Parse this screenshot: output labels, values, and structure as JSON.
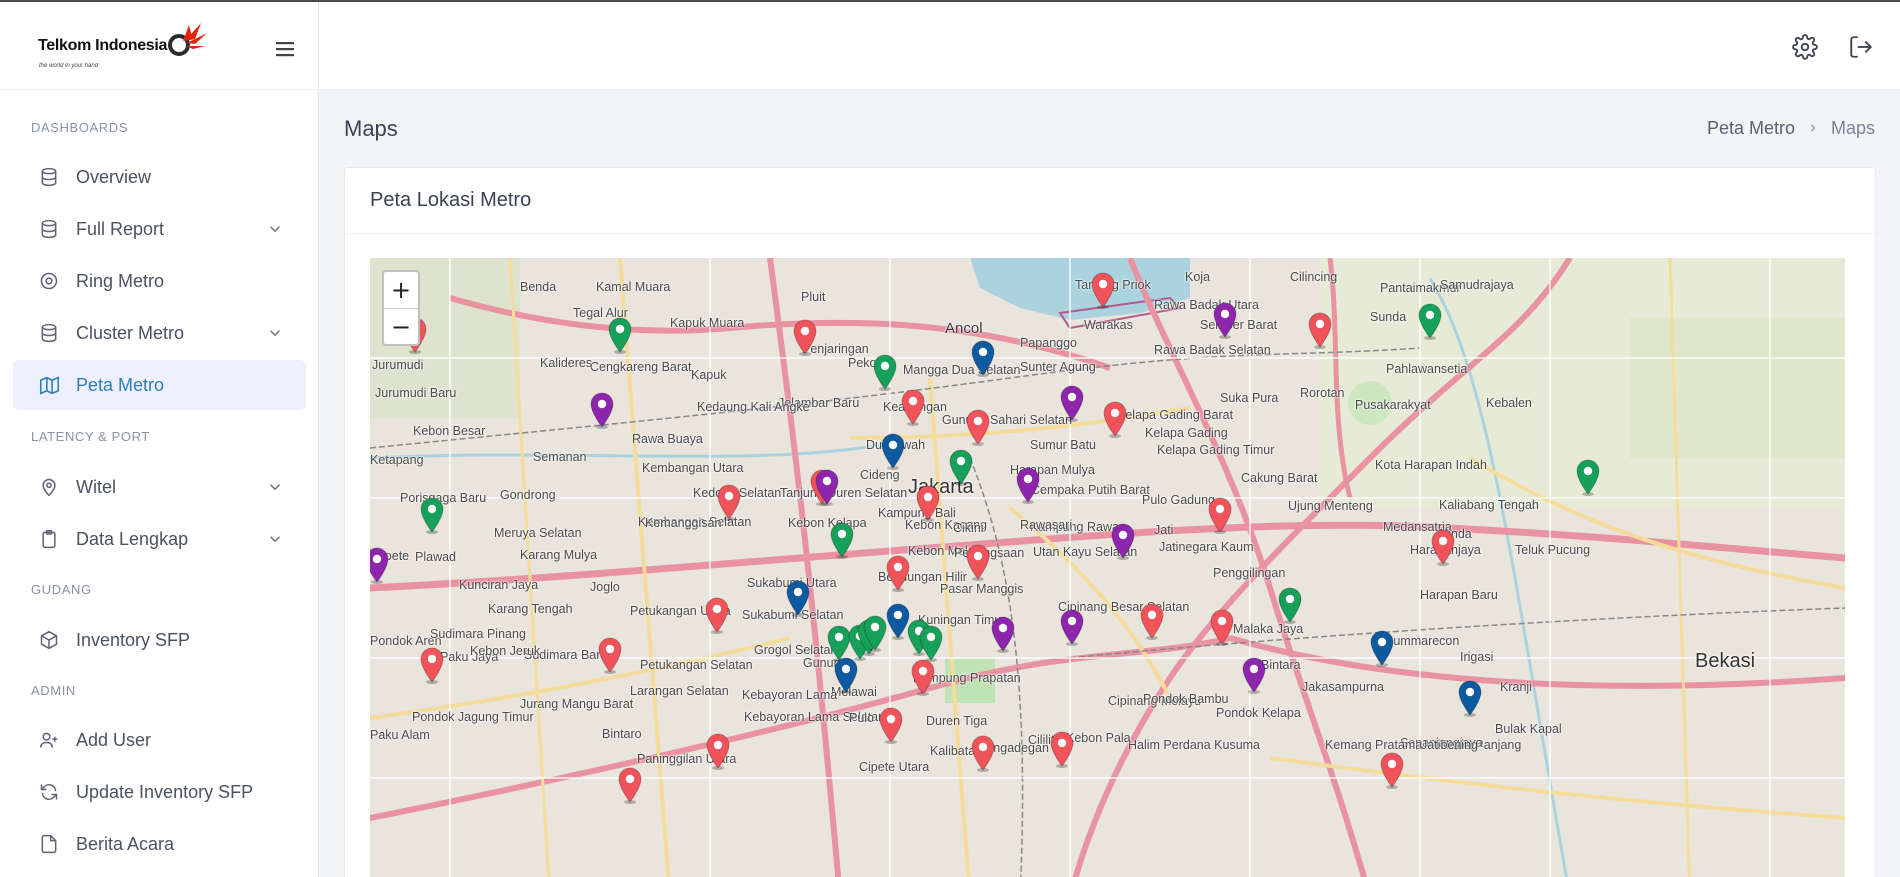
{
  "brand": {
    "name": "Telkom Indonesia",
    "tagline": "the world in your hand",
    "accent": "#e42313"
  },
  "sidebar": {
    "sections": [
      {
        "title": "DASHBOARDS",
        "items": [
          {
            "label": "Overview",
            "icon": "database-icon",
            "has_chevron": false
          },
          {
            "label": "Full Report",
            "icon": "database-icon",
            "has_chevron": true
          },
          {
            "label": "Ring Metro",
            "icon": "target-icon",
            "has_chevron": false
          },
          {
            "label": "Cluster Metro",
            "icon": "database-icon",
            "has_chevron": true
          },
          {
            "label": "Peta Metro",
            "icon": "map-icon",
            "has_chevron": false,
            "active": true
          }
        ]
      },
      {
        "title": "LATENCY & PORT",
        "items": [
          {
            "label": "Witel",
            "icon": "map-pin-icon",
            "has_chevron": true
          },
          {
            "label": "Data Lengkap",
            "icon": "clipboard-icon",
            "has_chevron": true
          }
        ]
      },
      {
        "title": "GUDANG",
        "items": [
          {
            "label": "Inventory SFP",
            "icon": "box-icon",
            "has_chevron": false
          }
        ]
      },
      {
        "title": "ADMIN",
        "items": [
          {
            "label": "Add User",
            "icon": "user-plus-icon",
            "has_chevron": false
          },
          {
            "label": "Update Inventory SFP",
            "icon": "refresh-icon",
            "has_chevron": false
          },
          {
            "label": "Berita Acara",
            "icon": "file-icon",
            "has_chevron": false
          }
        ]
      }
    ]
  },
  "topbar": {
    "settings_icon": "gear-icon",
    "logout_icon": "logout-icon"
  },
  "page": {
    "title": "Maps",
    "breadcrumb": [
      "Peta Metro",
      "Maps"
    ]
  },
  "card": {
    "title": "Peta Lokasi Metro"
  },
  "map": {
    "zoom_in": "+",
    "zoom_out": "−",
    "marker_colors": {
      "red": "#f0545a",
      "green": "#16a05a",
      "blue": "#0e5aa0",
      "purple": "#8e26ad"
    },
    "labels": [
      "Jakarta",
      "Bekasi",
      "Ancol",
      "Kapuk Muara",
      "Pluit",
      "Penjaringan",
      "Tegal Alur",
      "Cengkareng Barat",
      "Kapuk",
      "Jelambar Baru",
      "Kedaung Kali Angke",
      "Rawa Buaya",
      "Kembangan Utara",
      "Kembangan Selatan",
      "Kedoya Selatan",
      "Tanjung Duren Selatan",
      "Cideng",
      "Kampung Bali",
      "Kebon Kacang",
      "Kebon Melati",
      "Bendungan Hilir",
      "Sukabumi Utara",
      "Sukabumi Selatan",
      "Grogol Selatan",
      "Gunung",
      "Melawai",
      "Kebayoran Lama",
      "Kebayoran Lama Selatan",
      "Cipete Utara",
      "Pulo",
      "Duren Tiga",
      "Kalibata",
      "Pasar Manggis",
      "Kuningan Timur",
      "Kampung Prapatan",
      "Pegangsaan",
      "Cikini",
      "Kampung Rawa",
      "Cempaka Putih Barat",
      "Harapan Mulya",
      "Sumur Batu",
      "Gunung Sahari Selatan",
      "Mangga Dua Selatan",
      "Keagungan",
      "Pekojan",
      "Papanggo",
      "Sunter Agung",
      "Warakas",
      "Tanjung Priok",
      "Rawa Badak Utara",
      "Rawa Badak Selatan",
      "Koja",
      "Semper Barat",
      "Cilincing",
      "Kelapa Gading Barat",
      "Kelapa Gading Timur",
      "Pulo Gadung",
      "Jati",
      "Jatinegara Kaum",
      "Rawasari",
      "Utan Kayu Selatan",
      "Cipinang Besar Selatan",
      "Cipinang Melayu",
      "Pondok Bambu",
      "Halim Perdana Kusuma",
      "Kebon Pala",
      "Cililitan",
      "Pengadegan",
      "Pondok Kelapa",
      "Malaka Jaya",
      "Penggilingan",
      "Cakung Barat",
      "Ujung Menteng",
      "Rorotan",
      "Suka Pura",
      "Pusakarakyat",
      "Pahlawansetia",
      "Pantaimakmur",
      "Samudrajaya",
      "Kebalen",
      "Kaliabang Tengah",
      "Medansatria",
      "Harapanjaya",
      "Harapan Baru",
      "Summarecon",
      "Irigasi",
      "Jakasampurna",
      "Bintara",
      "Kranji",
      "Rawa Panjang",
      "Bulak Kapal",
      "Sepanjangjaya",
      "Kemang Pratama",
      "Jatibening",
      "Teluk Pucung",
      "Alinda",
      "Kota Harapan Indah",
      "Kelapa Gading",
      "Sunda",
      "Jurumudi",
      "Jurumudi Baru",
      "Kebon Besar",
      "Kalideres",
      "Semanan",
      "Benda",
      "Kamal Muara",
      "Pondok Jagung Timur",
      "Pondok Aren",
      "Paku Jaya",
      "Paku Alam",
      "Sudimara Pinang",
      "Karang Tengah",
      "Karang Mulya",
      "Kunciran Jaya",
      "Cipete",
      "Plawad",
      "Porisgaga Baru",
      "Ketapang",
      "Gondrong",
      "Meruya Selatan",
      "Joglo",
      "Petukangan Utara",
      "Petukangan Selatan",
      "Larangan Selatan",
      "Jurang Mangu Barat",
      "Bintaro",
      "Paninggilan Utara",
      "Sudimara Barat",
      "Kebon Jeruk",
      "Kemanggisan",
      "Kebon Kelapa",
      "Durisawah"
    ]
  }
}
